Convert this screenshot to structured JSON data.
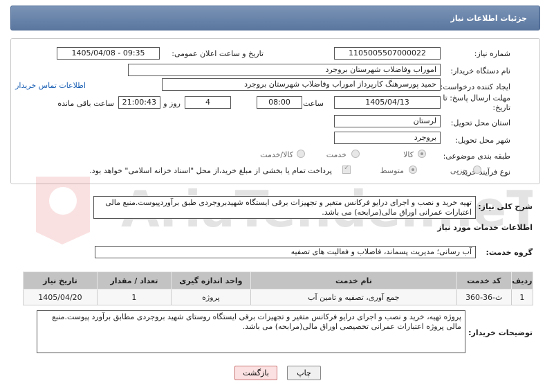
{
  "header": {
    "title": "جزئیات اطلاعات نیاز"
  },
  "form": {
    "need_number_label": "شماره نیاز:",
    "need_number": "1105005507000022",
    "announce_label": "تاریخ و ساعت اعلان عمومی:",
    "announce_value": "1405/04/08 - 09:35",
    "buyer_org_label": "نام دستگاه خریدار:",
    "buyer_org": "اموراب وفاضلاب شهرستان بروجرد",
    "creator_label": "ایجاد کننده درخواست:",
    "creator": "حمید پورسرهنگ کارپرداز اموراب وفاضلاب شهرستان بروجرد",
    "contact_link": "اطلاعات تماس خریدار",
    "deadline_label_1": "مهلت ارسال پاسخ: تا",
    "deadline_label_2": "تاریخ:",
    "deadline_date": "1405/04/13",
    "time_label": "ساعت",
    "deadline_time": "08:00",
    "days_value": "4",
    "days_label": "روز و",
    "remaining_time": "21:00:43",
    "remaining_label": "ساعت باقی مانده",
    "province_label": "استان محل تحویل:",
    "province": "لرستان",
    "city_label": "شهر محل تحویل:",
    "city": "بروجرد",
    "category_label": "طبقه بندی موضوعی:",
    "category_options": [
      "کالا",
      "خدمت",
      "کالا/خدمت"
    ],
    "purchase_type_label": "نوع فرآیند خرید :",
    "purchase_options": [
      "جزیی",
      "متوسط"
    ],
    "payment_note": "پرداخت تمام یا بخشی از مبلغ خرید،از محل \"اسناد خزانه اسلامی\" خواهد بود."
  },
  "summary": {
    "label": "شرح کلی نیاز:",
    "text": "تهیه خرید و نصب و اجرای درایو فرکانس متغیر و تجهیزات برقی ایستگاه شهیدبروجردی طبق برآوردپیوست.منبع مالی اعتبارات عمرانی اوراق مالی(مرابحه) می باشد."
  },
  "services": {
    "section_title": "اطلاعات خدمات مورد نیاز",
    "group_label": "گروه خدمت:",
    "group_value": "آب رسانی؛ مدیریت پسماند، فاضلاب و فعالیت های تصفیه",
    "columns": [
      "ردیف",
      "کد خدمت",
      "نام خدمت",
      "واحد اندازه گیری",
      "تعداد / مقدار",
      "تاریخ نیاز"
    ],
    "rows": [
      [
        "1",
        "ث-36-360",
        "جمع آوری، تصفیه و تامین آب",
        "پروژه",
        "1",
        "1405/04/20"
      ]
    ]
  },
  "buyer_notes": {
    "label": "توضیحات خریدار:",
    "text": "پروژه تهیه، خرید و نصب و اجرای درایو فرکانس متغیر و تجهیزات برقی ایستگاه روستای شهید بروجردی مطابق برآورد پیوست.منبع مالی پروژه اعتبارات عمرانی تخصیصی اوراق مالی(مرابحه) می باشد."
  },
  "buttons": {
    "print": "چاپ",
    "back": "بازگشت"
  },
  "colors": {
    "header_bg": "#5b779f",
    "link": "#1a5fb4",
    "table_header": "#c3c3c3"
  }
}
